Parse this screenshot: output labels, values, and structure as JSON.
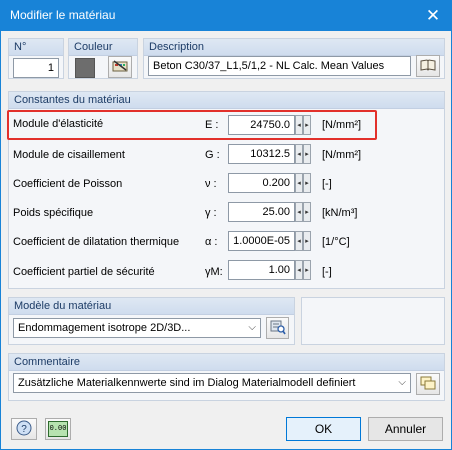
{
  "window": {
    "title": "Modifier le matériau"
  },
  "header": {
    "no_label": "N°",
    "no_value": "1",
    "color_label": "Couleur",
    "description_label": "Description",
    "description_value": "Beton C30/37_L1,5/1,2 - NL Calc. Mean Values"
  },
  "constants": {
    "title": "Constantes du matériau",
    "rows": [
      {
        "label": "Module d'élasticité",
        "symbol": "E :",
        "value": "24750.0",
        "unit": "[N/mm²]"
      },
      {
        "label": "Module de cisaillement",
        "symbol": "G :",
        "value": "10312.5",
        "unit": "[N/mm²]"
      },
      {
        "label": "Coefficient de Poisson",
        "symbol": "ν :",
        "value": "0.200",
        "unit": "[-]"
      },
      {
        "label": "Poids spécifique",
        "symbol": "γ :",
        "value": "25.00",
        "unit": "[kN/m³]"
      },
      {
        "label": "Coefficient de dilatation thermique",
        "symbol": "α :",
        "value": "1.0000E-05",
        "unit": "[1/°C]"
      },
      {
        "label": "Coefficient partiel de sécurité",
        "symbol": "γM:",
        "value": "1.00",
        "unit": "[-]"
      }
    ]
  },
  "model": {
    "title": "Modèle du matériau",
    "value": "Endommagement isotrope 2D/3D..."
  },
  "comment": {
    "title": "Commentaire",
    "value": "Zusätzliche Materialkennwerte sind im Dialog Materialmodell definiert"
  },
  "footer": {
    "ok_label": "OK",
    "cancel_label": "Annuler",
    "calc_icon_text": "0.00"
  },
  "colors": {
    "titlebar": "#1883d7",
    "highlight": "#e2302b",
    "swatch": "#6d6d6d"
  }
}
